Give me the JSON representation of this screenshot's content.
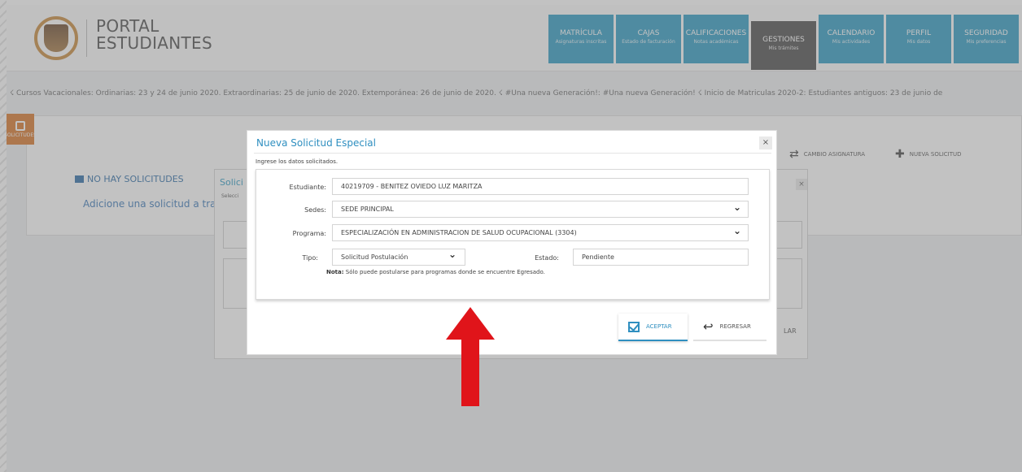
{
  "header": {
    "logo_line1": "PORTAL",
    "logo_line2": "ESTUDIANTES",
    "nav": [
      {
        "label": "MATRÍCULA",
        "sub": "Asignaturas inscritas",
        "active": false
      },
      {
        "label": "CAJAS",
        "sub": "Estado de facturación",
        "active": false
      },
      {
        "label": "CALIFICACIONES",
        "sub": "Notas académicas",
        "active": false
      },
      {
        "label": "GESTIONES",
        "sub": "Mis trámites",
        "active": true
      },
      {
        "label": "CALENDARIO",
        "sub": "Mis actividades",
        "active": false
      },
      {
        "label": "PERFIL",
        "sub": "Mis datos",
        "active": false
      },
      {
        "label": "SEGURIDAD",
        "sub": "Mis preferencias",
        "active": false
      }
    ]
  },
  "ticker": "☇ Cursos Vacacionales:  Ordinarias: 23 y 24 de junio 2020. Extraordinarias: 25 de junio de 2020. Extemporánea: 26 de junio de 2020. ☇  #Una nueva Generación!:  #Una nueva Generación! ☇  Inicio de Matriculas 2020-2:  Estudiantes antiguos: 23 de junio de",
  "side_tab": "SOLICITUDES",
  "page": {
    "no_requests": "NO HAY SOLICITUDES",
    "add_hint": "Adicione una solicitud a tra",
    "tool_change": "CAMBIO ASIGNATURA",
    "tool_new": "NUEVA SOLICITUD"
  },
  "back_dialog": {
    "title": "Solici",
    "subtitle": "Selecci",
    "close": "×",
    "cancel_fragment": "LAR"
  },
  "modal": {
    "title": "Nueva Solicitud Especial",
    "subtitle": "Ingrese los datos solicitados.",
    "close": "×",
    "labels": {
      "student": "Estudiante:",
      "campus": "Sedes:",
      "program": "Programa:",
      "type": "Tipo:",
      "status": "Estado:"
    },
    "values": {
      "student": "40219709 - BENITEZ OVIEDO LUZ MARITZA",
      "campus": "SEDE PRINCIPAL",
      "program": "ESPECIALIZACIÓN EN ADMINISTRACION DE SALUD OCUPACIONAL (3304)",
      "type": "Solicitud Postulación",
      "status": "Pendiente"
    },
    "note_label": "Nota:",
    "note_text": " Sólo puede postularse para programas donde se encuentre Egresado.",
    "accept": "ACEPTAR",
    "back": "REGRESAR"
  },
  "colors": {
    "nav_blue": "#2f9cc4",
    "nav_active": "#4e4e4e",
    "accent_orange": "#d9772b",
    "arrow_red": "#e0141a"
  }
}
